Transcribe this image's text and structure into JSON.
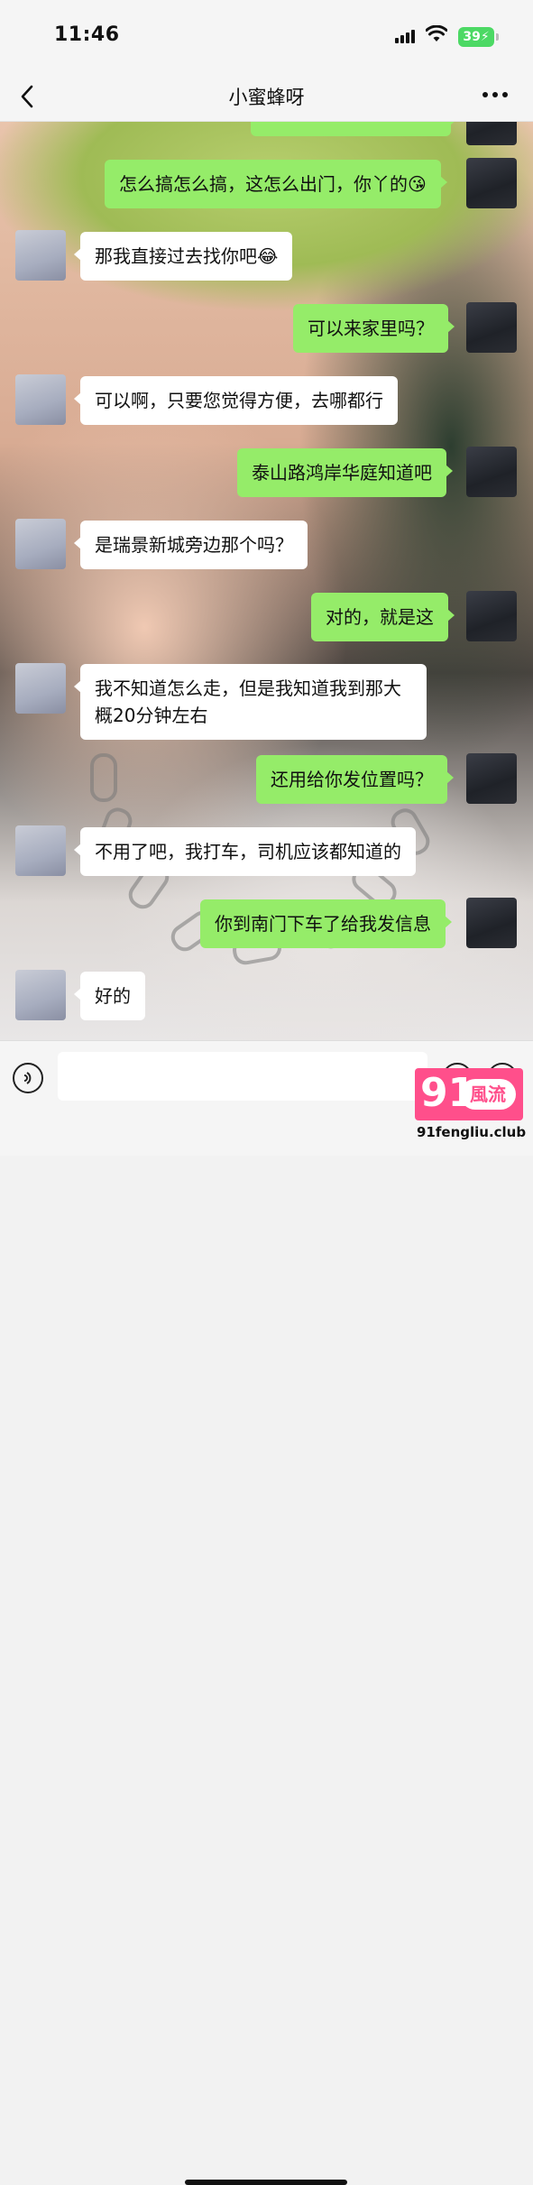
{
  "status_bar": {
    "time": "11:46",
    "battery": "39"
  },
  "nav": {
    "title": "小蜜蜂呀"
  },
  "messages": [
    {
      "side": "out",
      "text": ""
    },
    {
      "side": "out",
      "text": "怎么搞怎么搞，这怎么出门，你丫的😘"
    },
    {
      "side": "in",
      "text": "那我直接过去找你吧😂"
    },
    {
      "side": "out",
      "text": "可以来家里吗？"
    },
    {
      "side": "in",
      "text": "可以啊，只要您觉得方便，去哪都行"
    },
    {
      "side": "out",
      "text": "泰山路鸿岸华庭知道吧"
    },
    {
      "side": "in",
      "text": "是瑞景新城旁边那个吗？"
    },
    {
      "side": "out",
      "text": "对的，就是这"
    },
    {
      "side": "in",
      "text": "我不知道怎么走，但是我知道我到那大概20分钟左右"
    },
    {
      "side": "out",
      "text": "还用给你发位置吗？"
    },
    {
      "side": "in",
      "text": "不用了吧，我打车，司机应该都知道的"
    },
    {
      "side": "out",
      "text": "你到南门下车了给我发信息"
    },
    {
      "side": "in",
      "text": "好的"
    }
  ],
  "input": {
    "value": ""
  },
  "watermark": {
    "number": "91",
    "word": "風流",
    "url": "91fengliu.club"
  },
  "colors": {
    "outgoing_bubble": "#95ec69",
    "incoming_bubble": "#ffffff",
    "watermark": "#ff4f8b"
  },
  "icons": [
    "back-icon",
    "more-icon",
    "voice-icon",
    "emoji-icon",
    "plus-icon",
    "signal-icon",
    "wifi-icon",
    "battery-icon"
  ]
}
